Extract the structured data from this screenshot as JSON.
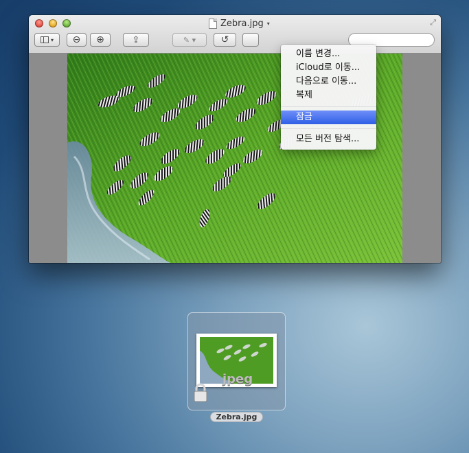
{
  "window": {
    "title": "Zebra.jpg",
    "title_caret": "▾",
    "fullscreen_glyph": "⤢",
    "toolbar": {
      "sidebar_button_icon": "sidebar-icon",
      "zoom_out_icon": "zoom-out-icon",
      "zoom_in_icon": "zoom-in-icon",
      "share_icon": "share-icon",
      "markup_icon": "pencil-icon",
      "rotate_icon": "rotate-icon",
      "sidebar_glyph": "▾",
      "zoom_out_glyph": "⊖",
      "zoom_in_glyph": "⊕",
      "share_glyph": "⇪",
      "markup_glyph": "✎ ▾",
      "rotate_glyph": "↺"
    }
  },
  "menu": {
    "items": [
      {
        "label": "이름 변경..."
      },
      {
        "label": "iCloud로 이동..."
      },
      {
        "label": "다음으로 이동..."
      },
      {
        "label": "복제"
      },
      {
        "label": "잠금",
        "selected": true
      },
      {
        "label": "모든 버전 탐색..."
      }
    ],
    "accent": "#3a66e8"
  },
  "drag": {
    "extension_label": "jpeg",
    "file_name": "Zebra.jpg",
    "lock_icon": "lock-icon"
  },
  "colors": {
    "grass": "#4e9a22",
    "water": "#7b9ab8",
    "desktop": "#2a5583"
  }
}
